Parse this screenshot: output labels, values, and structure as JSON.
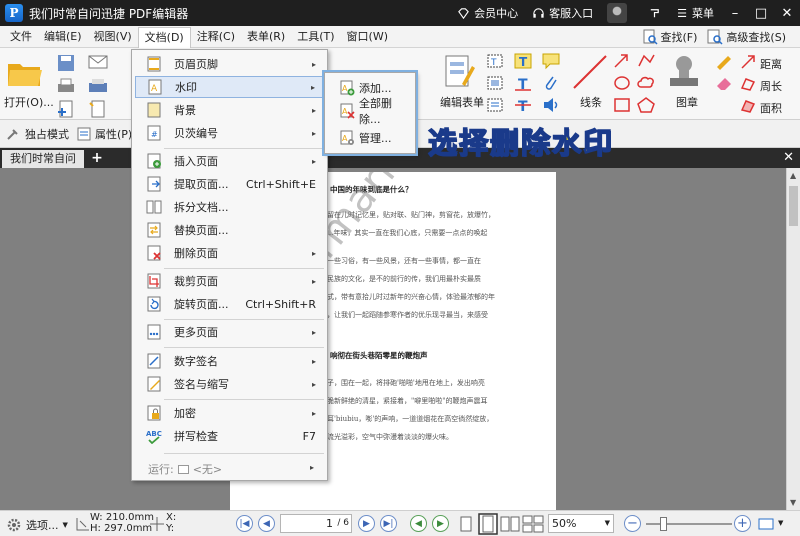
{
  "titlebar": {
    "logo_letter": "P",
    "title": "我们时常自问迅捷 PDF编辑器",
    "member_center": "会员中心",
    "customer_service": "客服入口",
    "menu_label": "菜单",
    "minimize": "–",
    "maximize": "□",
    "close": "✕"
  },
  "menubar": {
    "items": [
      "文件",
      "编辑(E)",
      "视图(V)",
      "文档(D)",
      "注释(C)",
      "表单(R)",
      "工具(T)",
      "窗口(W)"
    ],
    "find": "查找(F)",
    "advanced_find": "高级查找(S)"
  },
  "ribbon": {
    "open": "打开(O)...",
    "edit_form": "编辑表单",
    "lines": "线条",
    "image": "图章",
    "distance": "距离",
    "perimeter": "周长",
    "area": "面积"
  },
  "subbar": {
    "exclusive_mode": "独占模式",
    "properties": "属性(P)..."
  },
  "tabs": {
    "doc_tab": "我们时常自问",
    "add": "+",
    "close": "✕"
  },
  "dropdown": {
    "items": [
      {
        "label": "页眉页脚",
        "shortcut": "",
        "arrow": "▸"
      },
      {
        "label": "水印",
        "shortcut": "",
        "arrow": "▸"
      },
      {
        "label": "背景",
        "shortcut": "",
        "arrow": "▸"
      },
      {
        "label": "贝茨编号",
        "shortcut": "",
        "arrow": "▸"
      },
      {
        "label": "插入页面",
        "shortcut": "",
        "arrow": "▸"
      },
      {
        "label": "提取页面...",
        "shortcut": "Ctrl+Shift+E",
        "arrow": ""
      },
      {
        "label": "拆分文档...",
        "shortcut": "",
        "arrow": ""
      },
      {
        "label": "替换页面...",
        "shortcut": "",
        "arrow": ""
      },
      {
        "label": "删除页面",
        "shortcut": "",
        "arrow": "▸"
      },
      {
        "label": "裁剪页面",
        "shortcut": "",
        "arrow": "▸"
      },
      {
        "label": "旋转页面...",
        "shortcut": "Ctrl+Shift+R",
        "arrow": ""
      },
      {
        "label": "更多页面",
        "shortcut": "",
        "arrow": "▸"
      },
      {
        "label": "数字签名",
        "shortcut": "",
        "arrow": "▸"
      },
      {
        "label": "签名与缩写",
        "shortcut": "",
        "arrow": "▸"
      },
      {
        "label": "加密",
        "shortcut": "",
        "arrow": "▸"
      },
      {
        "label": "拼写检查",
        "shortcut": "F7",
        "arrow": ""
      }
    ],
    "run_label": "运行:",
    "run_value": "<无>",
    "run_arrow": "▸"
  },
  "submenu": {
    "items": [
      "添加...",
      "全部删除...",
      "管理..."
    ]
  },
  "annotation": "选择删除水印",
  "document": {
    "heading1": "中国的年味到底是什么？",
    "heading2": "响彻在街头巷陌零星的鞭炮声",
    "lines": [
      "还留在儿时记忆里，贴对联、贴门神，剪窗花，放爆竹，",
      "......年味，其实一直在我们心底，只需要一点点的唤起",
      "有一些习俗，有一些风景，还有一些事情，都一直在",
      "个民族的文化，是不的前行的传，我们用最朴实最质",
      "方式，带有意拾儿时过新年的兴奋心情，体验最浓郁的年",
      "节，让我们一起蹈随参寒作者的优乐现寻最当，来感受",
      "孩子，围在一起，将排砲'啪啪'地甩在地上，发出响亮",
      "清脆新鲜绝的清星，紧接着，\"噼里啪啦\"的鞭炮声震耳",
      "入耳'biubiu，嘭'的声响，一道道烟花在高空徜然绽放，",
      "，流光溢彩，空气中弥漫着淡淡的爆火味。"
    ],
    "watermark": "Watermark Sample"
  },
  "statusbar": {
    "options": "选项...",
    "width": "W: 210.0mm",
    "height": "H: 297.0mm",
    "x_label": "X:",
    "y_label": "Y:",
    "page_value": "1",
    "page_total": "/ 6",
    "zoom": "50%"
  }
}
